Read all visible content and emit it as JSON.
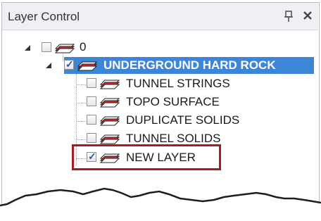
{
  "panel": {
    "title": "Layer Control",
    "pin_icon": "pin-icon",
    "close_icon": "close-icon"
  },
  "tree": {
    "root": {
      "label": "0",
      "checked": false,
      "expanded": true
    },
    "group": {
      "label": "UNDERGROUND HARD ROCK",
      "checked": true,
      "expanded": true,
      "selected": true
    },
    "children": [
      {
        "label": "TUNNEL STRINGS",
        "checked": false
      },
      {
        "label": "TOPO SURFACE",
        "checked": false
      },
      {
        "label": "DUPLICATE SOLIDS",
        "checked": false
      },
      {
        "label": "TUNNEL SOLIDS",
        "checked": false
      },
      {
        "label": "NEW LAYER",
        "checked": true,
        "highlighted": true
      }
    ]
  },
  "colors": {
    "selection": "#3c85d7",
    "highlight_border": "#a31d22",
    "layer_icon": "#d7262c"
  }
}
